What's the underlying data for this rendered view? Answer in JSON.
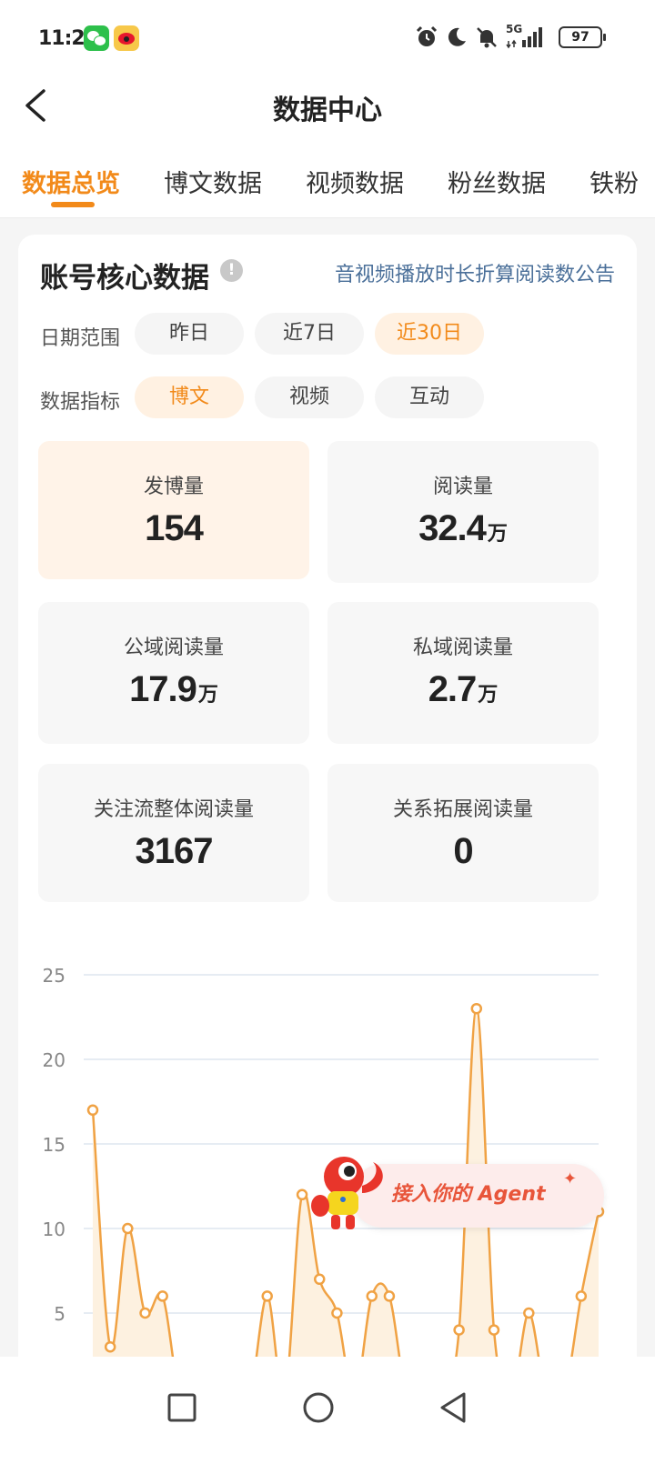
{
  "status_bar": {
    "time": "11:28",
    "network": "5G",
    "battery": "97"
  },
  "nav": {
    "title": "数据中心"
  },
  "tabs": [
    "数据总览",
    "博文数据",
    "视频数据",
    "粉丝数据",
    "铁粉"
  ],
  "card": {
    "title": "账号核心数据",
    "notice_link": "音视频播放时长折算阅读数公告",
    "date_range": {
      "label": "日期范围",
      "options": [
        "昨日",
        "近7日",
        "近30日"
      ],
      "selected": "近30日"
    },
    "metric": {
      "label": "数据指标",
      "options": [
        "博文",
        "视频",
        "互动"
      ],
      "selected": "博文"
    },
    "stats": [
      {
        "label": "发博量",
        "value": "154",
        "unit": ""
      },
      {
        "label": "阅读量",
        "value": "32.4",
        "unit": "万"
      },
      {
        "label": "公域阅读量",
        "value": "17.9",
        "unit": "万"
      },
      {
        "label": "私域阅读量",
        "value": "2.7",
        "unit": "万"
      },
      {
        "label": "关注流整体阅读量",
        "value": "3167",
        "unit": ""
      },
      {
        "label": "关系拓展阅读量",
        "value": "0",
        "unit": ""
      }
    ]
  },
  "chart_data": {
    "type": "area",
    "ylim": [
      0,
      25
    ],
    "y_ticks": [
      "5",
      "10",
      "15",
      "20",
      "25"
    ],
    "x": [
      1,
      2,
      3,
      4,
      5,
      6,
      7,
      8,
      9,
      10,
      11,
      12,
      13,
      14,
      15,
      16,
      17,
      18,
      19,
      20,
      21,
      22,
      23,
      24,
      25,
      26,
      27,
      28,
      29,
      30
    ],
    "values": [
      17,
      3,
      10,
      5,
      6,
      0,
      0,
      0,
      0,
      0,
      6,
      0,
      12,
      7,
      5,
      0,
      6,
      6,
      0,
      0,
      0,
      4,
      23,
      4,
      0,
      5,
      0,
      0,
      6,
      11
    ],
    "line_color": "#f0a244",
    "fill_color": "#fdf1e0"
  },
  "agent_banner": {
    "text": "接入你的 Agent"
  }
}
